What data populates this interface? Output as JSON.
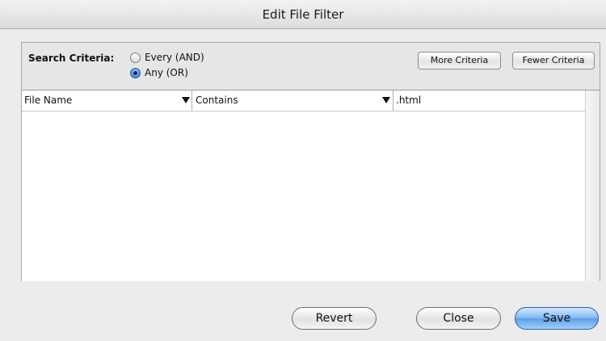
{
  "window": {
    "title": "Edit File Filter"
  },
  "criteria": {
    "label": "Search Criteria:",
    "options": [
      {
        "label": "Every (AND)",
        "selected": false
      },
      {
        "label": "Any (OR)",
        "selected": true
      }
    ],
    "more_label": "More Criteria",
    "fewer_label": "Fewer Criteria"
  },
  "rows": [
    {
      "field": "File Name",
      "operator": "Contains",
      "value": ".html"
    }
  ],
  "footer": {
    "revert_label": "Revert",
    "close_label": "Close",
    "save_label": "Save"
  },
  "colors": {
    "default_button": "#6aa8ee",
    "radio_selected": "#3c86e0"
  }
}
